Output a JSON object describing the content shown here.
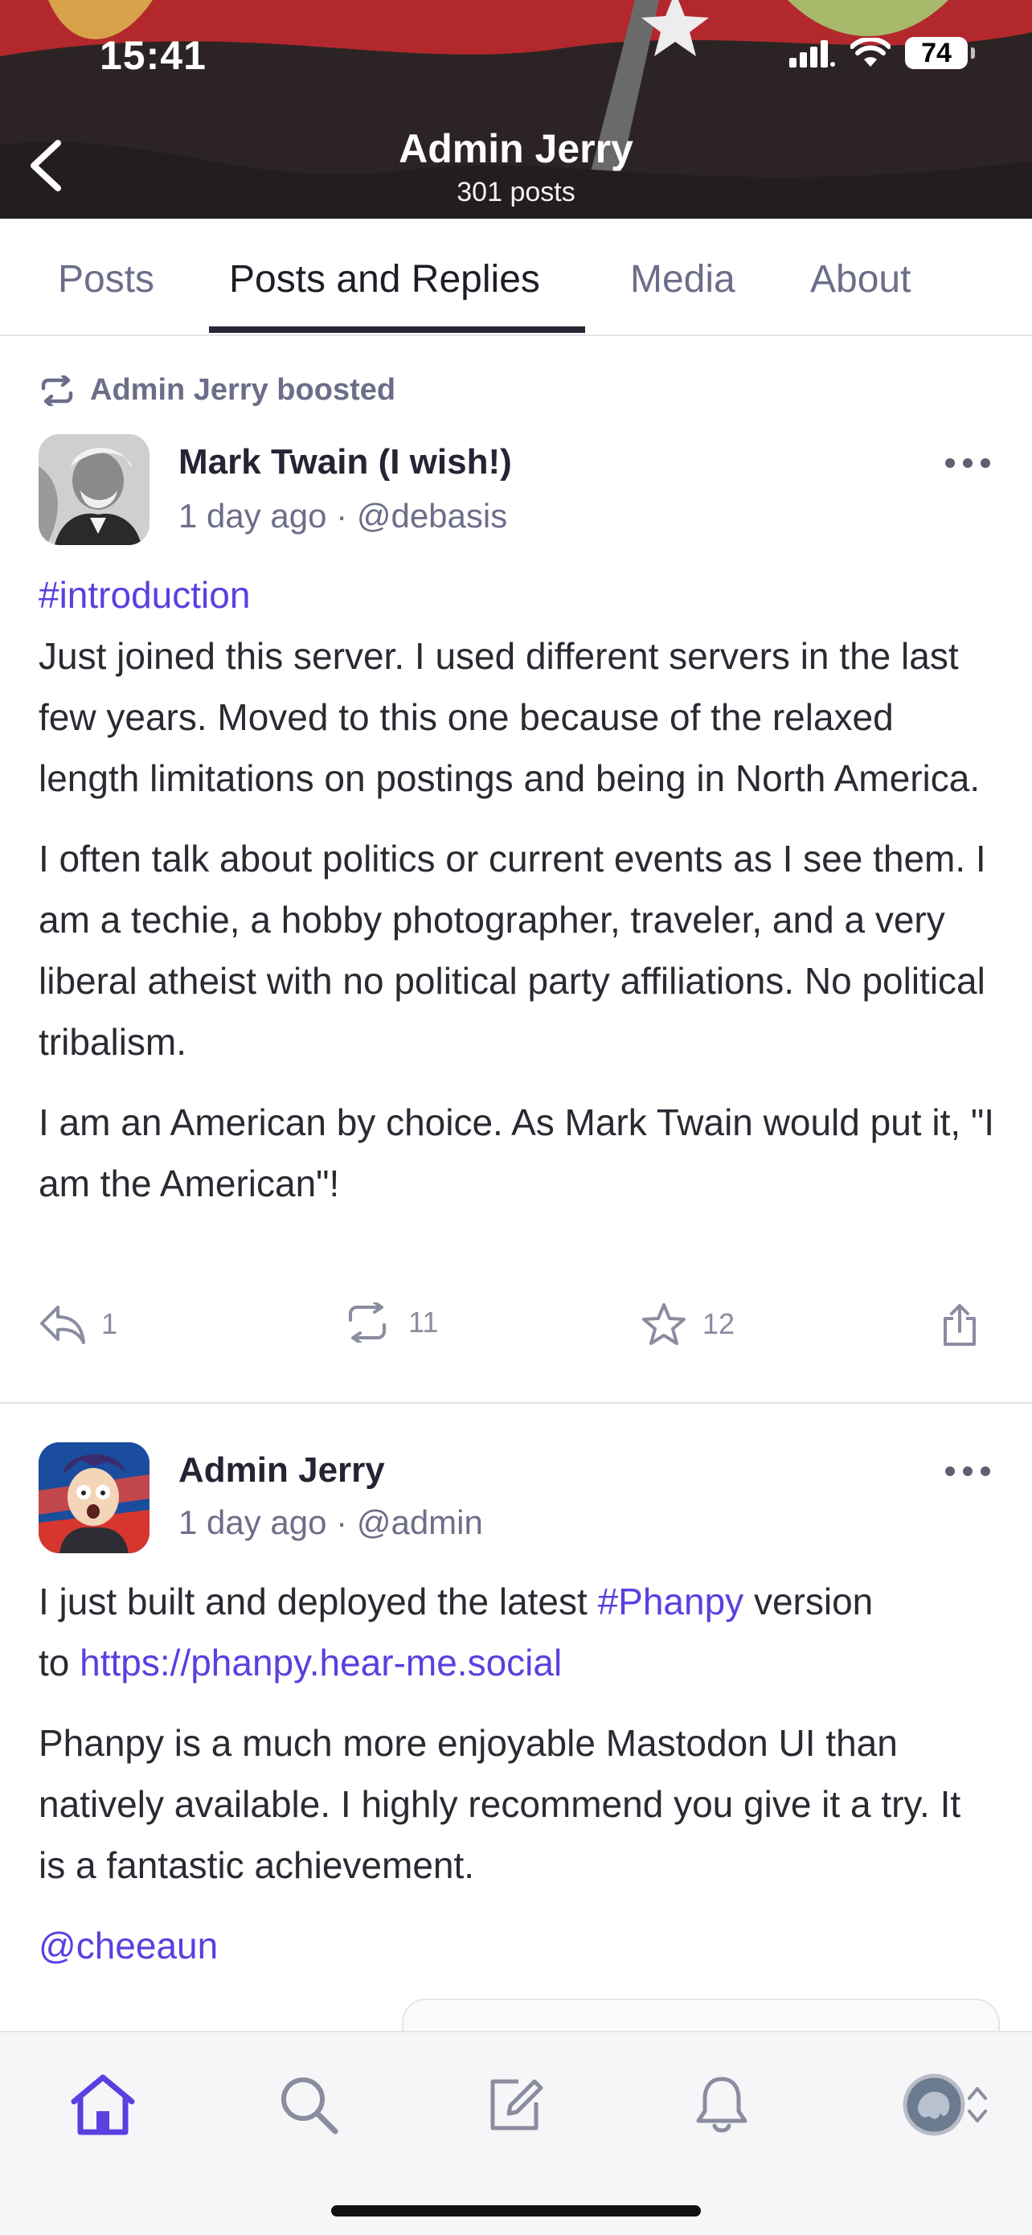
{
  "status_bar": {
    "time": "15:41",
    "battery": "74"
  },
  "header": {
    "title": "Admin Jerry",
    "subtitle": "301 posts"
  },
  "tabs": [
    {
      "label": "Posts"
    },
    {
      "label": "Posts and Replies",
      "active": true
    },
    {
      "label": "Media"
    },
    {
      "label": "About"
    }
  ],
  "post1": {
    "boosted_by": "Admin Jerry boosted",
    "author": "Mark Twain (I wish!)",
    "time": "1 day ago",
    "handle": "@debasis",
    "hashtag": "#introduction",
    "paragraphs": [
      "Just joined this server. I used different servers in the last few years. Moved to this one because of the relaxed length limitations on postings and being in North America.",
      "I often talk about politics or current events as I see them. I am a techie, a hobby photographer, traveler, and a very liberal atheist with no political party affiliations. No political tribalism.",
      "I am an American by choice. As Mark Twain would put it, \"I am the American\"!"
    ],
    "replies": "1",
    "boosts": "11",
    "favourites": "12"
  },
  "post2": {
    "author": "Admin Jerry",
    "time": "1 day ago",
    "handle": "@admin",
    "line1_prefix": "I just built and deployed the latest ",
    "hashtag": "#Phanpy",
    "line1_suffix": " version",
    "line2_prefix": "to ",
    "link": "https://phanpy.hear-me.social",
    "paragraph2": "Phanpy is a much more enjoyable Mastodon UI than natively available. I highly recommend you give it a try. It is a fantastic achievement.",
    "mention": "@cheeaun"
  },
  "bottom_nav": [
    {
      "name": "home",
      "active": true
    },
    {
      "name": "search"
    },
    {
      "name": "compose"
    },
    {
      "name": "notifications"
    },
    {
      "name": "account"
    }
  ],
  "colors": {
    "accent": "#5b3fe0",
    "muted": "#6c6e89",
    "header_bg": "#2c2424"
  }
}
